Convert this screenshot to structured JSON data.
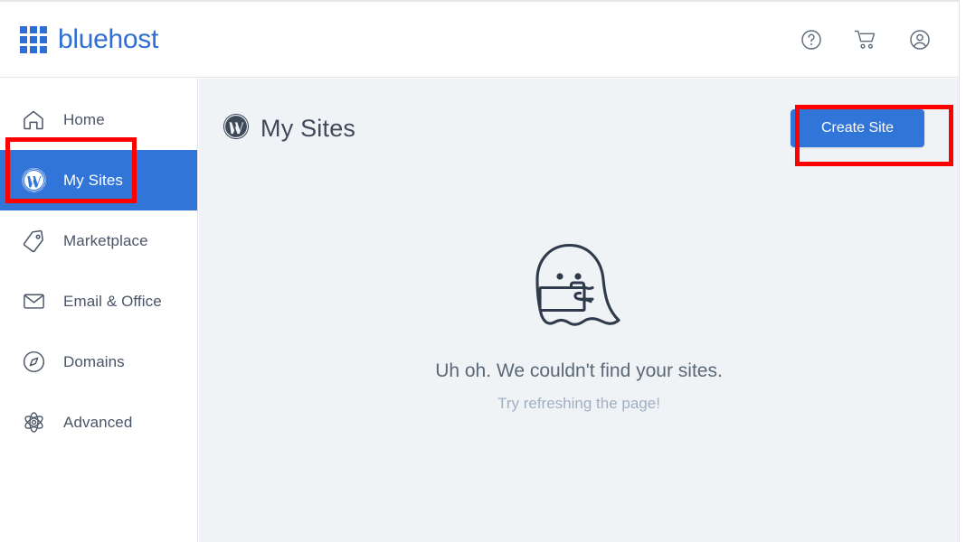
{
  "brand": {
    "name": "bluehost",
    "logo_icon": "grid-3x3-icon",
    "color": "#2f6fd4"
  },
  "header": {
    "icons": [
      {
        "name": "help-icon",
        "label": "Help"
      },
      {
        "name": "cart-icon",
        "label": "Cart"
      },
      {
        "name": "account-icon",
        "label": "Account"
      }
    ]
  },
  "sidebar": {
    "items": [
      {
        "label": "Home",
        "icon": "home-icon",
        "active": false
      },
      {
        "label": "My Sites",
        "icon": "wordpress-icon",
        "active": true
      },
      {
        "label": "Marketplace",
        "icon": "price-tag-icon",
        "active": false
      },
      {
        "label": "Email & Office",
        "icon": "envelope-icon",
        "active": false
      },
      {
        "label": "Domains",
        "icon": "compass-icon",
        "active": false
      },
      {
        "label": "Advanced",
        "icon": "atom-icon",
        "active": false
      }
    ],
    "active_bg": "#3275d8"
  },
  "main": {
    "title": "My Sites",
    "title_icon": "wordpress-icon",
    "create_button": "Create Site",
    "create_button_color": "#3275d8",
    "empty_state": {
      "illustration": "ghost-icon",
      "primary_text": "Uh oh. We couldn't find your sites.",
      "secondary_text": "Try refreshing the page!"
    },
    "background": "#f0f3f6"
  },
  "annotations": {
    "color": "#ff0000",
    "boxes": [
      {
        "name": "sidebar-my-sites-highlight",
        "target": "My Sites"
      },
      {
        "name": "create-site-highlight",
        "target": "Create Site"
      }
    ]
  }
}
